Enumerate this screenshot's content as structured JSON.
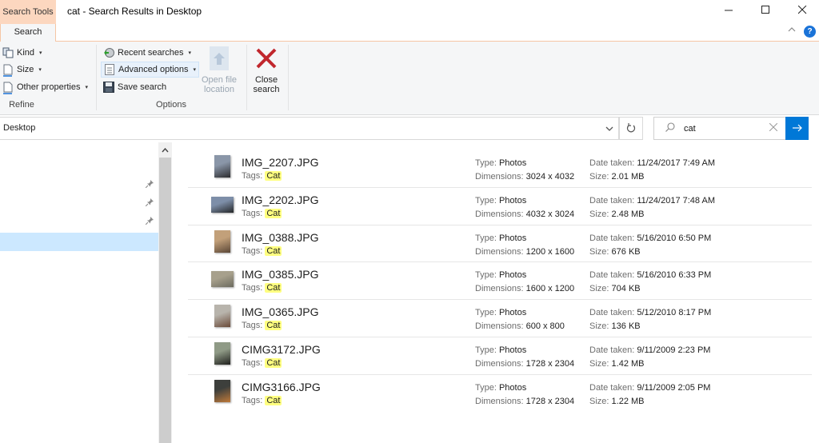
{
  "window": {
    "context_tab": "Search Tools",
    "title": "cat - Search Results in Desktop",
    "minimize_icon": "minimize-icon",
    "maximize_icon": "maximize-icon",
    "close_icon": "close-icon"
  },
  "ribbon": {
    "tabs": [
      {
        "label": "Search",
        "active": true
      }
    ],
    "collapse_icon": "chevron-up-icon",
    "help_label": "?",
    "refine": {
      "label": "Refine",
      "items": [
        {
          "label": "Kind",
          "icon": "kind-icon"
        },
        {
          "label": "Size",
          "icon": "size-icon"
        },
        {
          "label": "Other properties",
          "icon": "properties-icon"
        }
      ]
    },
    "options": {
      "label": "Options",
      "recent_searches": "Recent searches",
      "advanced_options": "Advanced options",
      "save_search": "Save search",
      "open_file_location": "Open file location",
      "open_file_location_line1": "Open file",
      "open_file_location_line2": "location"
    },
    "close_search": {
      "line1": "Close",
      "line2": "search"
    },
    "dropdown_arrow": "▾"
  },
  "address_bar": {
    "path": "Desktop",
    "dropdown_icon": "chevron-down-icon",
    "refresh_icon": "refresh-icon"
  },
  "search": {
    "value": "cat",
    "placeholder": "",
    "clear_icon": "clear-icon",
    "go_icon": "arrow-right-icon"
  },
  "navigation_pane": {
    "pinned_count": 3,
    "selected_index": 4
  },
  "results_labels": {
    "tags": "Tags:",
    "type": "Type:",
    "dimensions": "Dimensions:",
    "date_taken": "Date taken:",
    "size": "Size:"
  },
  "results": [
    {
      "name": "IMG_2207.JPG",
      "tag": "Cat",
      "type": "Photos",
      "dimensions": "3024 x 4032",
      "date_taken": "11/24/2017 7:49 AM",
      "size": "2.01 MB",
      "orientation": "portrait",
      "thumb_colors": [
        "#8a96a8",
        "#2b2b2e"
      ]
    },
    {
      "name": "IMG_2202.JPG",
      "tag": "Cat",
      "type": "Photos",
      "dimensions": "4032 x 3024",
      "date_taken": "11/24/2017 7:48 AM",
      "size": "2.48 MB",
      "orientation": "landscape",
      "thumb_colors": [
        "#7d8ea8",
        "#242628"
      ]
    },
    {
      "name": "IMG_0388.JPG",
      "tag": "Cat",
      "type": "Photos",
      "dimensions": "1200 x 1600",
      "date_taken": "5/16/2010 6:50 PM",
      "size": "676 KB",
      "orientation": "portrait",
      "thumb_colors": [
        "#c2a07a",
        "#5a4636"
      ]
    },
    {
      "name": "IMG_0385.JPG",
      "tag": "Cat",
      "type": "Photos",
      "dimensions": "1600 x 1200",
      "date_taken": "5/16/2010 6:33 PM",
      "size": "704 KB",
      "orientation": "landscape",
      "thumb_colors": [
        "#a7a08c",
        "#6c6b5f"
      ]
    },
    {
      "name": "IMG_0365.JPG",
      "tag": "Cat",
      "type": "Photos",
      "dimensions": "600 x 800",
      "date_taken": "5/12/2010 8:17 PM",
      "size": "136 KB",
      "orientation": "portrait",
      "thumb_colors": [
        "#b8b4ac",
        "#6a4a38"
      ]
    },
    {
      "name": "CIMG3172.JPG",
      "tag": "Cat",
      "type": "Photos",
      "dimensions": "1728 x 2304",
      "date_taken": "9/11/2009 2:23 PM",
      "size": "1.42 MB",
      "orientation": "portrait",
      "thumb_colors": [
        "#8f9a86",
        "#1e1f1c"
      ]
    },
    {
      "name": "CIMG3166.JPG",
      "tag": "Cat",
      "type": "Photos",
      "dimensions": "1728 x 2304",
      "date_taken": "9/11/2009 2:05 PM",
      "size": "1.22 MB",
      "orientation": "portrait",
      "thumb_colors": [
        "#3d3f3c",
        "#c07a3a"
      ]
    }
  ],
  "colors": {
    "context_tab": "#fcd7bf",
    "accent": "#0078d7",
    "tag_highlight": "#ffff80",
    "selection": "#cce8ff",
    "close_search_x": "#c1272d"
  }
}
